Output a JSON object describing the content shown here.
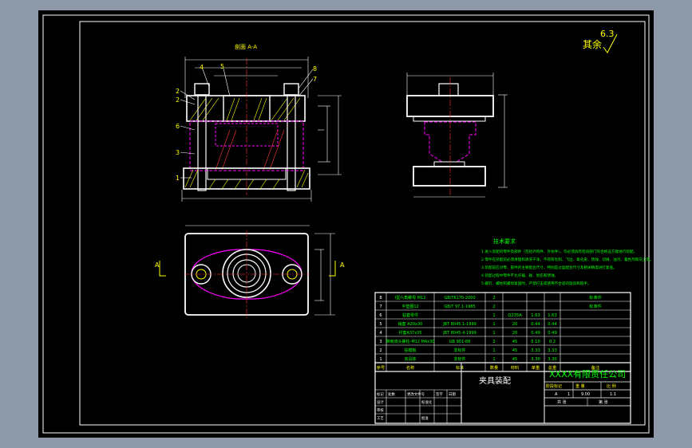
{
  "title_block": {
    "company": "XXXX有限责任公司",
    "drawing_name": "夹具装配",
    "scale_label": "比 例",
    "scale_value": "1:1",
    "quantity_label": "数 量",
    "weight_label": "重 量",
    "stage_label": "阶段标记",
    "mark": "A",
    "qty": "1",
    "weight": "9.00",
    "sheet_total": "共 张",
    "sheet_no": "第 张",
    "rows": {
      "mark": "标记",
      "count": "处数",
      "change": "更改文件号",
      "sign": "签字",
      "date": "日期",
      "design": "设计",
      "check": "审核",
      "process": "工艺",
      "approve": "批准",
      "standard": "标准化"
    }
  },
  "section_label": "剖面 A-A",
  "roughness": {
    "label": "其余",
    "value": "6.3"
  },
  "view_marks": {
    "left": "A",
    "right": "A"
  },
  "tech_req": {
    "heading": "技术要求",
    "lines": [
      "1.进入装配的零件及部件（包括外购件、外协件），均必须具有检验部门的合格证方能进行装配。",
      "2.零件在装配前必须清理和清洗干净，不得有毛刺、飞边、氧化皮、锈蚀、切屑、油污、着色剂和灰尘等。",
      "3.装配前应对零、部件的主要配合尺寸，特别是过盈配合尺寸及相关精度进行复查。",
      "4.装配过程中零件不允许磕、碰、划伤和锈蚀。",
      "5.螺钉、螺栓和螺母紧固时，严禁打击或使用不合适的旋具和扳手。"
    ]
  },
  "bom": {
    "header": [
      "序号",
      "名称",
      "标准",
      "数量",
      "材料",
      "单重",
      "总重",
      "备注"
    ],
    "rows": [
      [
        "8",
        "I型六角螺母 M12",
        "GB/T6170-2000",
        "2",
        "",
        "",
        "",
        "标准件"
      ],
      [
        "7",
        "平垫圈12",
        "GB/T 97.1-1985",
        "2",
        "",
        "",
        "",
        "标准件"
      ],
      [
        "6",
        "钻套零件",
        "",
        "1",
        "Q235A",
        "1.63",
        "1.63",
        ""
      ],
      [
        "5",
        "销套 A20x30",
        "JBT 8045.1-1999",
        "1",
        "20",
        "0.44",
        "0.44",
        ""
      ],
      [
        "4",
        "衬套A37x35",
        "JBT 8045.4-1999",
        "1",
        "20",
        "0.49",
        "0.49",
        ""
      ],
      [
        "3",
        "带肩双头螺柱-M12 M4x30",
        "GB 901-88",
        "2",
        "45",
        "0.10",
        "0.2",
        ""
      ],
      [
        "2",
        "钻模板",
        "非标件",
        "1",
        "45",
        "3.33",
        "3.33",
        ""
      ],
      [
        "1",
        "夹具体",
        "非标件",
        "1",
        "45",
        "3.30",
        "3.30",
        ""
      ]
    ]
  },
  "leaders": [
    "1",
    "2",
    "2",
    "6",
    "4",
    "5",
    "8",
    "7",
    "3"
  ]
}
